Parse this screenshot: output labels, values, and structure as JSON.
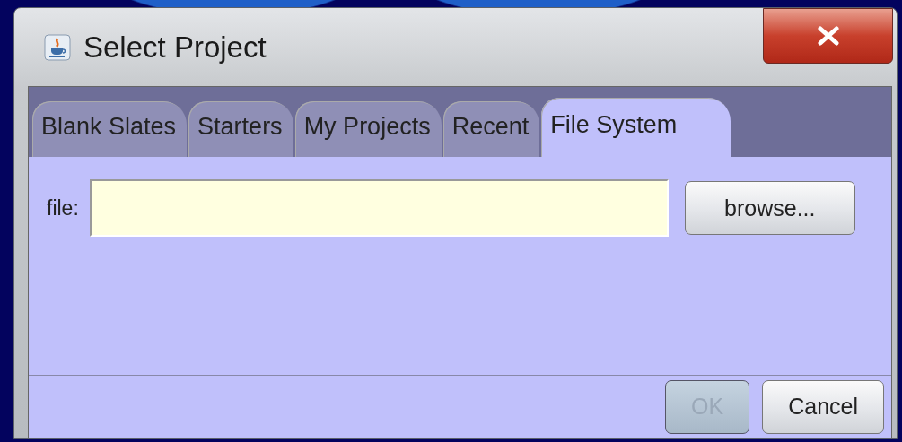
{
  "window": {
    "title": "Select Project"
  },
  "tabs": [
    {
      "label": "Blank Slates",
      "selected": false
    },
    {
      "label": "Starters",
      "selected": false
    },
    {
      "label": "My Projects",
      "selected": false
    },
    {
      "label": "Recent",
      "selected": false
    },
    {
      "label": "File System",
      "selected": true
    }
  ],
  "file_field": {
    "label": "file:"
  },
  "browse_button": {
    "label": "browse..."
  },
  "buttons": [
    {
      "label": "OK",
      "disabled": true
    },
    {
      "label": "Cancel",
      "disabled": false
    }
  ]
}
